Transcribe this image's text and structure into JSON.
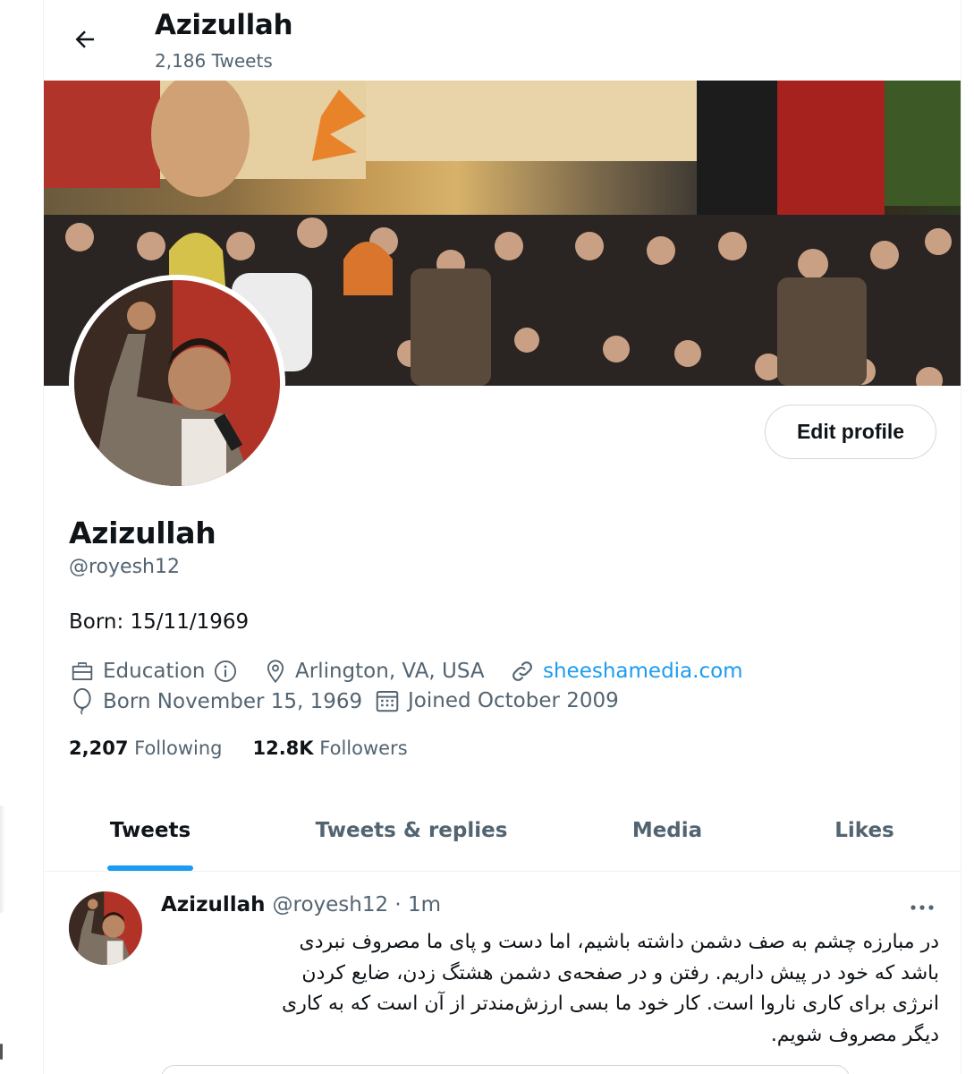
{
  "header": {
    "title": "Azizullah",
    "tweet_count": "2,186 Tweets"
  },
  "profile": {
    "name": "Azizullah",
    "handle": "@royesh12",
    "bio": "Born: 15/11/1969",
    "edit_label": "Edit profile",
    "category": "Education",
    "location": "Arlington, VA, USA",
    "website": "sheeshamedia.com",
    "birthday": "Born November 15, 1969",
    "joined": "Joined October 2009",
    "following_count": "2,207",
    "following_label": "Following",
    "followers_count": "12.8K",
    "followers_label": "Followers"
  },
  "tabs": [
    {
      "label": "Tweets",
      "active": true
    },
    {
      "label": "Tweets & replies",
      "active": false
    },
    {
      "label": "Media",
      "active": false
    },
    {
      "label": "Likes",
      "active": false
    }
  ],
  "tweet": {
    "name": "Azizullah",
    "meta": "@royesh12 · 1m",
    "lines": [
      "در مبارزه چشم به صف دشمن داشته باشیم، اما دست و پای ما مصروف نبردی",
      "باشد که خود در پیش داریم. رفتن و در صفحه‌ی دشمن هشتگ زدن، ضایع کردن",
      "انرژی برای کاری ناروا است. کار خود ما بسی ارزش‌مندتر از آن است که به کاری",
      "دیگر مصروف شویم."
    ]
  },
  "colors": {
    "accent": "#1d9bf0",
    "text_primary": "#0f1419",
    "text_secondary": "#536471",
    "border": "#cfd9de"
  },
  "icons": {
    "back": "arrow-left-icon",
    "category": "briefcase-icon",
    "category_info": "info-icon",
    "location": "location-pin-icon",
    "website": "link-icon",
    "birthday": "balloon-icon",
    "joined": "calendar-icon",
    "more": "more-horizontal-icon"
  }
}
